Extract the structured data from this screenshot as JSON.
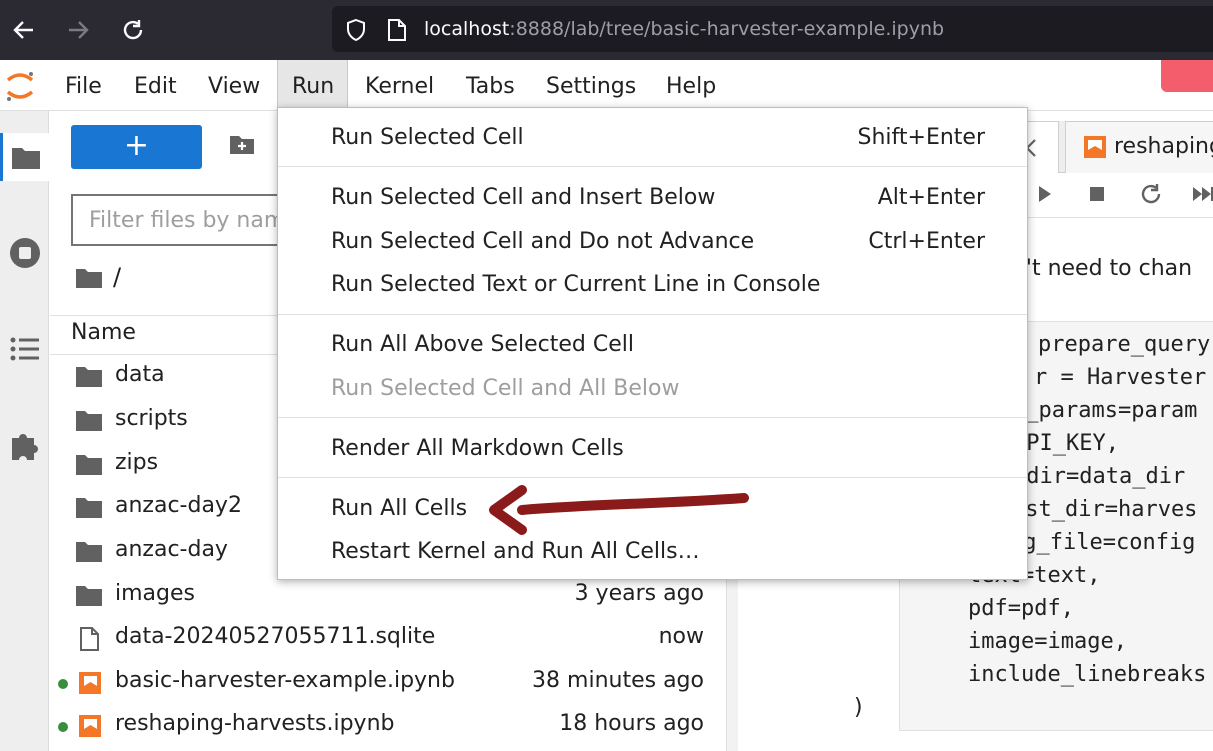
{
  "browser": {
    "url_host": "localhost",
    "url_path": ":8888/lab/tree/basic-harvester-example.ipynb"
  },
  "menubar": {
    "items": [
      "File",
      "Edit",
      "View",
      "Run",
      "Kernel",
      "Tabs",
      "Settings",
      "Help"
    ],
    "active": "Run"
  },
  "filebrowser": {
    "new_label": "+",
    "filter_placeholder": "Filter files by name",
    "breadcrumb": "/",
    "column_name": "Name",
    "files": [
      {
        "name": "data",
        "type": "folder",
        "modified": ""
      },
      {
        "name": "scripts",
        "type": "folder",
        "modified": ""
      },
      {
        "name": "zips",
        "type": "folder",
        "modified": ""
      },
      {
        "name": "anzac-day2",
        "type": "folder",
        "modified": ""
      },
      {
        "name": "anzac-day",
        "type": "folder",
        "modified": ""
      },
      {
        "name": "images",
        "type": "folder",
        "modified": "3 years ago"
      },
      {
        "name": "data-20240527055711.sqlite",
        "type": "file",
        "modified": "now"
      },
      {
        "name": "basic-harvester-example.ipynb",
        "type": "notebook",
        "modified": "38 minutes ago",
        "running": true
      },
      {
        "name": "reshaping-harvests.ipynb",
        "type": "notebook",
        "modified": "18 hours ago",
        "running": true
      }
    ]
  },
  "notebook": {
    "tab_label": "reshaping",
    "markdown_fragment": "dn't need to chan",
    "code_lines": [
      "prepare_query",
      "r = Harvester",
      "y_params=param",
      "API_KEY,",
      "_dir=data_dir",
      "est_dir=harves",
      "ig_file=config",
      "text=text,",
      "pdf=pdf,",
      "image=image,",
      "include_linebreaks",
      ")"
    ]
  },
  "run_menu": {
    "items": [
      {
        "label": "Run Selected Cell",
        "shortcut": "Shift+Enter",
        "enabled": true
      },
      {
        "label": "Run Selected Cell and Insert Below",
        "shortcut": "Alt+Enter",
        "enabled": true
      },
      {
        "label": "Run Selected Cell and Do not Advance",
        "shortcut": "Ctrl+Enter",
        "enabled": true
      },
      {
        "label": "Run Selected Text or Current Line in Console",
        "shortcut": "",
        "enabled": true
      },
      {
        "label": "Run All Above Selected Cell",
        "shortcut": "",
        "enabled": true
      },
      {
        "label": "Run Selected Cell and All Below",
        "shortcut": "",
        "enabled": false
      },
      {
        "label": "Render All Markdown Cells",
        "shortcut": "",
        "enabled": true
      },
      {
        "label": "Run All Cells",
        "shortcut": "",
        "enabled": true
      },
      {
        "label": "Restart Kernel and Run All Cells…",
        "shortcut": "",
        "enabled": true
      }
    ]
  },
  "colors": {
    "accent": "#1976d2",
    "annotation_arrow": "#8b1a1a",
    "running_dot": "#388e3c",
    "notebook_icon": "#f37726"
  }
}
